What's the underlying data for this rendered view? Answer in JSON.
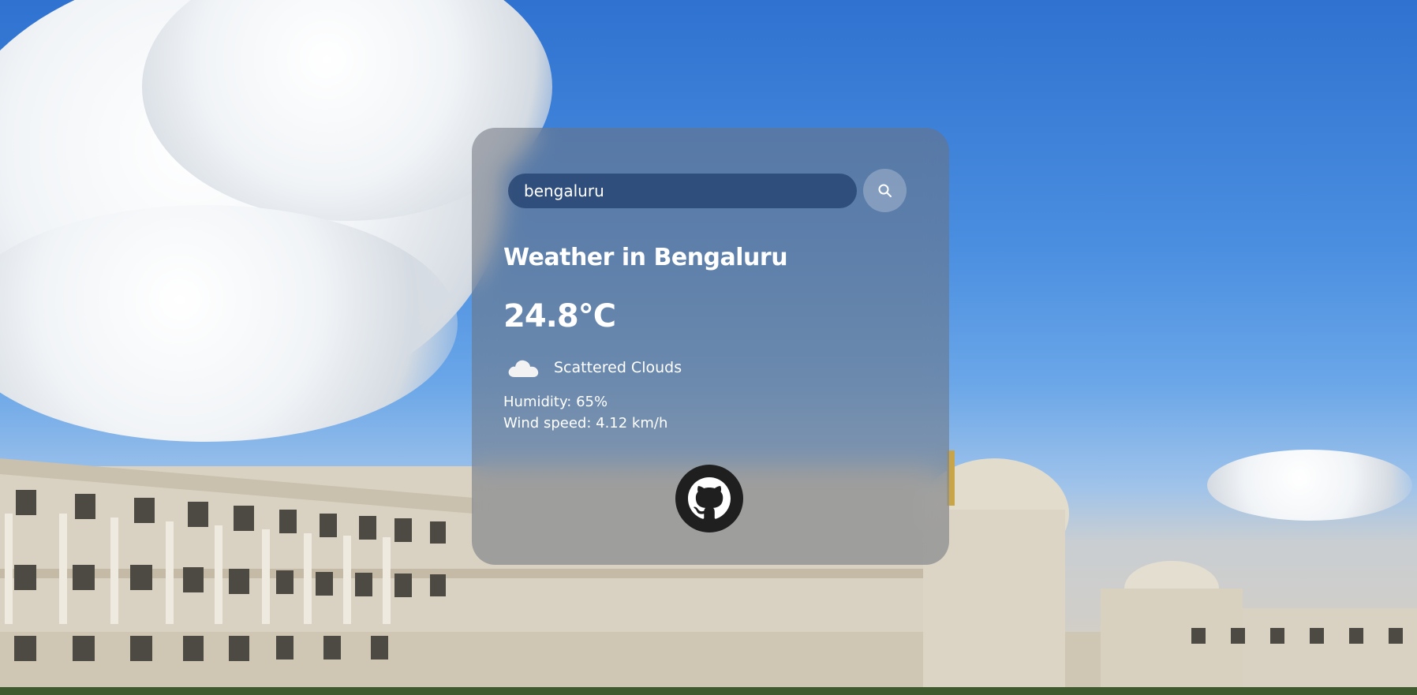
{
  "search": {
    "value": "bengaluru",
    "icon": "search-icon"
  },
  "weather": {
    "title": "Weather in Bengaluru",
    "temperature": "24.8°C",
    "condition_icon": "cloud-icon",
    "description": "Scattered Clouds",
    "humidity": "Humidity: 65%",
    "wind": "Wind speed: 4.12 km/h"
  },
  "footer": {
    "icon": "github-icon"
  },
  "colors": {
    "card_bg": "#6e737d",
    "input_bg": "#28467a",
    "github_bg": "#1f1f1f",
    "text": "#ffffff"
  }
}
